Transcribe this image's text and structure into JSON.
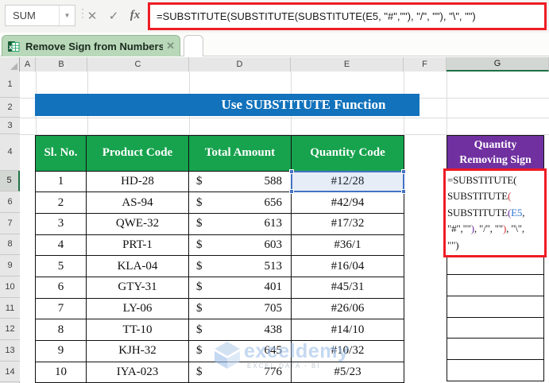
{
  "topbar": {
    "name_box": "SUM",
    "name_box_caret": "▼",
    "cancel_icon": "✕",
    "enter_icon": "✓",
    "fx_icon": "fx",
    "formula": "=SUBSTITUTE(SUBSTITUTE(SUBSTITUTE(E5, \"#\",\"\"), \"/\", \"\"), \"\\\", \"\")",
    "formula_box_color": "#ee1c25"
  },
  "tabstrip": {
    "active_tab": "Remove Sign from Numbers *",
    "close_icon": "✕",
    "tab_color": "#b9d8ba"
  },
  "grid": {
    "column_headers": [
      "A",
      "B",
      "C",
      "D",
      "E",
      "F",
      "G"
    ],
    "row_headers": [
      "1",
      "2",
      "3",
      "4",
      "5",
      "6",
      "7",
      "8",
      "9",
      "10",
      "11",
      "12",
      "13",
      "14"
    ],
    "selected_column": "G",
    "selected_row": "5"
  },
  "title_banner": {
    "text": "Use SUBSTITUTE Function",
    "bg_color": "#1272bb"
  },
  "table": {
    "headers": [
      "Sl. No.",
      "Product Code",
      "Total Amount",
      "Quantity Code"
    ],
    "header_bg": "#17a24d",
    "rows": [
      {
        "sl": "1",
        "code": "HD-28",
        "cur": "$",
        "amt": "588",
        "qty": "#12/28"
      },
      {
        "sl": "2",
        "code": "AS-94",
        "cur": "$",
        "amt": "656",
        "qty": "#42/94"
      },
      {
        "sl": "3",
        "code": "QWE-32",
        "cur": "$",
        "amt": "613",
        "qty": "#17/32"
      },
      {
        "sl": "4",
        "code": "PRT-1",
        "cur": "$",
        "amt": "603",
        "qty": "#36/1"
      },
      {
        "sl": "5",
        "code": "KLA-04",
        "cur": "$",
        "amt": "513",
        "qty": "#16/04"
      },
      {
        "sl": "6",
        "code": "GTY-31",
        "cur": "$",
        "amt": "401",
        "qty": "#45/31"
      },
      {
        "sl": "7",
        "code": "LY-06",
        "cur": "$",
        "amt": "705",
        "qty": "#26/06"
      },
      {
        "sl": "8",
        "code": "TT-10",
        "cur": "$",
        "amt": "438",
        "qty": "#14/10"
      },
      {
        "sl": "9",
        "code": "KJH-32",
        "cur": "$",
        "amt": "645",
        "qty": "#10/32"
      },
      {
        "sl": "10",
        "code": "IYA-023",
        "cur": "$",
        "amt": "776",
        "qty": "#5/23"
      }
    ]
  },
  "result_column": {
    "header_line1": "Quantity",
    "header_line2": "Removing Sign",
    "header_bg": "#7030a0",
    "formula_lines": [
      [
        {
          "t": "=SUBSTITUTE(",
          "c": "#1a1a1a"
        }
      ],
      [
        {
          "t": "SUBSTITUTE",
          "c": "#1a1a1a"
        },
        {
          "t": "(",
          "c": "#d13438"
        }
      ],
      [
        {
          "t": "SUBSTITUTE",
          "c": "#1a1a1a"
        },
        {
          "t": "(",
          "c": "#7030a0"
        },
        {
          "t": "E5",
          "c": "#2e75d4"
        },
        {
          "t": ",",
          "c": "#1a1a1a"
        }
      ],
      [
        {
          "t": "\"#\",\"\"",
          "c": "#1a1a1a"
        },
        {
          "t": ")",
          "c": "#7030a0"
        },
        {
          "t": ", \"/\", \"\"",
          "c": "#1a1a1a"
        },
        {
          "t": ")",
          "c": "#d13438"
        },
        {
          "t": ", \"\\\",",
          "c": "#1a1a1a"
        }
      ],
      [
        {
          "t": "\"\")",
          "c": "#1a1a1a"
        }
      ]
    ],
    "empty_cell_count": 6
  },
  "selection": {
    "ref_cell": "E5",
    "color": "#4472c4"
  },
  "watermark": {
    "brand": "exceldemy",
    "tagline": "EXCEL DATA - BI",
    "color": "#9dbfe8"
  }
}
